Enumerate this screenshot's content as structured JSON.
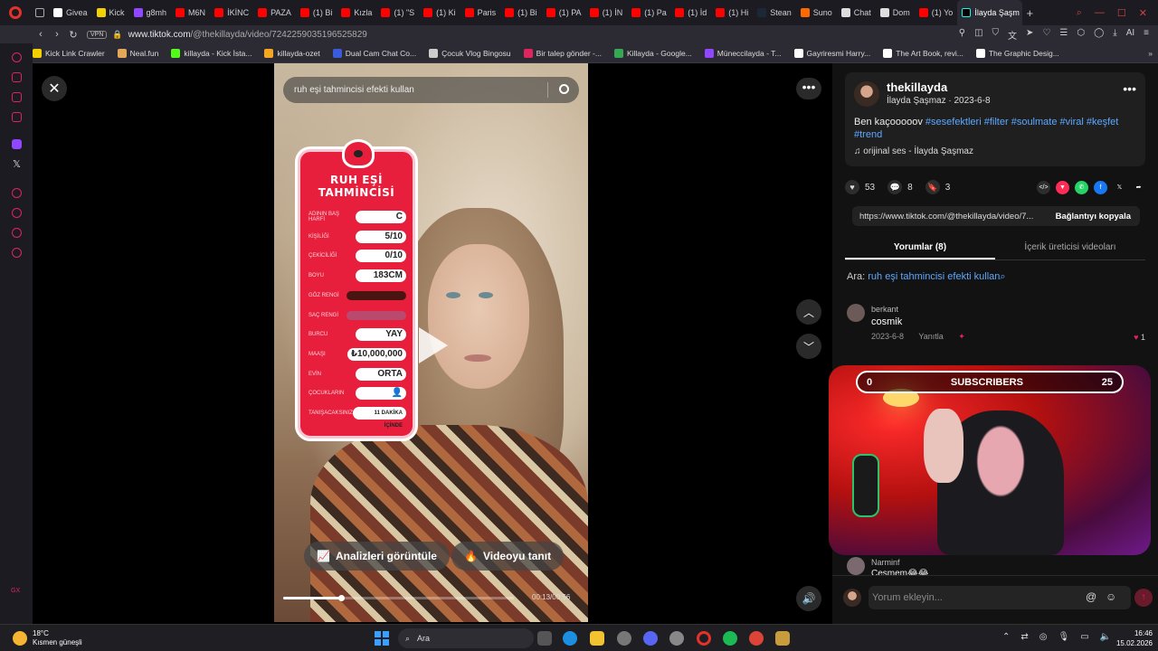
{
  "browser": {
    "tabs": [
      {
        "label": "Givea",
        "color": "#ffffff"
      },
      {
        "label": "Kick",
        "color": "#f3d000"
      },
      {
        "label": "g8mh",
        "color": "#9146ff"
      },
      {
        "label": "M6N",
        "color": "#ff0000"
      },
      {
        "label": "İKİNC",
        "color": "#ff0000"
      },
      {
        "label": "PAZA",
        "color": "#ff0000"
      },
      {
        "label": "(1) Bi",
        "color": "#ff0000"
      },
      {
        "label": "Kızla",
        "color": "#ff0000"
      },
      {
        "label": "(1) \"S",
        "color": "#ff0000"
      },
      {
        "label": "(1) Ki",
        "color": "#ff0000"
      },
      {
        "label": "Paris",
        "color": "#ff0000"
      },
      {
        "label": "(1) Bi",
        "color": "#ff0000"
      },
      {
        "label": "(1) PA",
        "color": "#ff0000"
      },
      {
        "label": "(1) İN",
        "color": "#ff0000"
      },
      {
        "label": "(1) Pa",
        "color": "#ff0000"
      },
      {
        "label": "(1) İd",
        "color": "#ff0000"
      },
      {
        "label": "(1) Hi",
        "color": "#ff0000"
      },
      {
        "label": "Stean",
        "color": "#1b2838"
      },
      {
        "label": "Suno",
        "color": "#ff6a00"
      },
      {
        "label": "Chat",
        "color": "#dddddd"
      },
      {
        "label": "Dom",
        "color": "#dddddd"
      },
      {
        "label": "(1) Yo",
        "color": "#ff0000"
      }
    ],
    "active_tab": "İlayda Şaşm",
    "new_tab_symbol": "+",
    "url_prefix": "www.tiktok.com",
    "url_path": "/@thekillayda/video/7242259035196525829",
    "vpn_label": "VPN",
    "ai_label": "AI",
    "bookmarks": [
      {
        "label": "Kick Link Crawler",
        "color": "#f3d000"
      },
      {
        "label": "Neal.fun",
        "color": "#e3a857"
      },
      {
        "label": "killayda - Kick İsta...",
        "color": "#53fc18"
      },
      {
        "label": "killayda-ozet",
        "color": "#f5a623"
      },
      {
        "label": "Dual Cam Chat Co...",
        "color": "#3b5bdb"
      },
      {
        "label": "Çocuk Vlog Bingosu",
        "color": "#cccccc"
      },
      {
        "label": "Bir talep gönder -...",
        "color": "#e0245e"
      },
      {
        "label": "Killayda - Google...",
        "color": "#34a853"
      },
      {
        "label": "Müneccilayda - T...",
        "color": "#9146ff"
      },
      {
        "label": "Gayriresmi Harry...",
        "color": "#ffffff"
      },
      {
        "label": "The Art Book, revi...",
        "color": "#ffffff"
      },
      {
        "label": "The Graphic Desig...",
        "color": "#ffffff"
      }
    ]
  },
  "video": {
    "search_placeholder": "ruh eşi tahmincisi efekti kullan",
    "analytics_label": "Analizleri görüntüle",
    "promote_label": "Videoyu tanıt",
    "progress_fraction": 0.25,
    "timecode": "00:13/00:56",
    "filter": {
      "title_line1": "RUH EŞİ",
      "title_line2": "TAHMİNCİSİ",
      "rows": [
        {
          "label": "ADININ BAŞ HARFİ",
          "value": "C"
        },
        {
          "label": "KİŞİLİĞİ",
          "value": "5/10"
        },
        {
          "label": "ÇEKİCİLİĞİ",
          "value": "0/10"
        },
        {
          "label": "BOYU",
          "value": "183CM"
        },
        {
          "label": "GÖZ RENGİ",
          "value": "",
          "bar": "#4a1410"
        },
        {
          "label": "SAÇ RENGİ",
          "value": "",
          "bar": "#b94a6e"
        },
        {
          "label": "BURCU",
          "value": "YAY"
        },
        {
          "label": "MAAŞI",
          "value": "₺10,000,000"
        },
        {
          "label": "EVİN",
          "value": "ORTA"
        },
        {
          "label": "ÇOCUKLARIN",
          "value": "👤"
        },
        {
          "label": "TANIŞACAKSINIZ",
          "value": "11 DAKİKA İÇİNDE"
        }
      ]
    }
  },
  "post": {
    "username": "thekillayda",
    "display_name": "İlayda Şaşmaz",
    "date": "2023-6-8",
    "caption_text": "Ben kaçooooov",
    "hashtags": [
      "#sesefektleri",
      "#filter",
      "#soulmate",
      "#viral",
      "#keşfet",
      "#trend"
    ],
    "music": "orijinal ses - İlayda Şaşmaz",
    "likes": "53",
    "comments": "8",
    "saves": "3",
    "link": "https://www.tiktok.com/@thekillayda/video/7...",
    "copy_link": "Bağlantıyı kopyala",
    "tab_comments": "Yorumlar (8)",
    "tab_creator": "İçerik üreticisi videoları",
    "search_label": "Ara:",
    "search_query": "ruh eşi tahmincisi efekti kullan"
  },
  "comments": [
    {
      "user": "berkant",
      "text": "cosmik",
      "date": "2023-6-8",
      "reply": "Yanıtla",
      "likes": "1"
    },
    {
      "user": "Narminf",
      "text": "Cesmem😂😂"
    }
  ],
  "overlay": {
    "subscribers_label": "SUBSCRIBERS",
    "left_count": "0",
    "right_count": "25"
  },
  "composer": {
    "placeholder": "Yorum ekleyin..."
  },
  "taskbar": {
    "temp": "18°C",
    "weather": "Kısmen güneşli",
    "search": "Ara",
    "time": "16:46",
    "date": "15.02.2026"
  }
}
